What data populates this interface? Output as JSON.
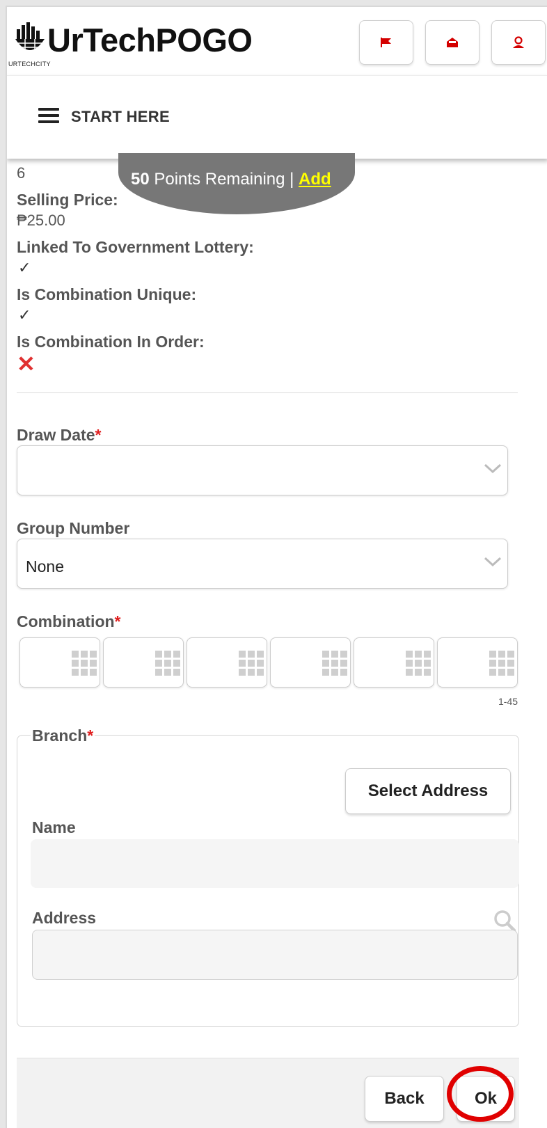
{
  "header": {
    "logo_text": "UrTechPOGO",
    "logo_sub": "URTECHCITY",
    "icons": [
      "flag-icon",
      "inbox-icon",
      "user-icon"
    ],
    "accent": "#d40000"
  },
  "nav": {
    "menu_label": "START HERE"
  },
  "points": {
    "count": "50",
    "text": " Points Remaining | ",
    "add": "Add"
  },
  "details": {
    "partial_value": "6",
    "selling_price_label": "Selling Price:",
    "selling_price_value": "₱25.00",
    "linked_label": "Linked To Government Lottery:",
    "linked_value": "✓",
    "unique_label": "Is Combination Unique:",
    "unique_value": "✓",
    "in_order_label": "Is Combination In Order:",
    "in_order_value": "✕"
  },
  "form": {
    "draw_date_label": "Draw Date",
    "draw_date_value": "",
    "group_number_label": "Group Number",
    "group_number_value": "None",
    "combination_label": "Combination",
    "combination_range": "1-45",
    "required_mark": "*"
  },
  "branch": {
    "legend": "Branch",
    "select_address_label": "Select Address",
    "name_label": "Name",
    "name_value": "",
    "address_label": "Address",
    "address_value": ""
  },
  "footer": {
    "back_label": "Back",
    "ok_label": "Ok"
  }
}
